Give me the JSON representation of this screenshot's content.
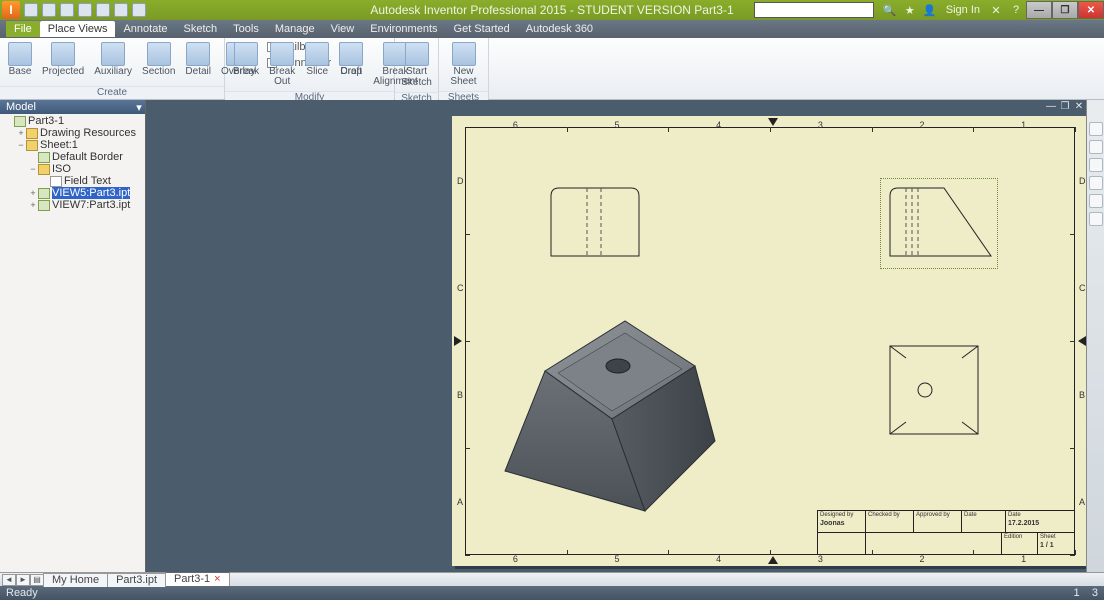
{
  "title": "Autodesk Inventor Professional 2015 - STUDENT VERSION   Part3-1",
  "signin": "Sign In",
  "menus": [
    "File",
    "Place Views",
    "Annotate",
    "Sketch",
    "Tools",
    "Manage",
    "View",
    "Environments",
    "Get Started",
    "Autodesk 360"
  ],
  "activeMenu": "Place Views",
  "ribbon": {
    "create": {
      "title": "Create",
      "buttons": [
        {
          "l": "Base"
        },
        {
          "l": "Projected"
        },
        {
          "l": "Auxiliary"
        },
        {
          "l": "Section"
        },
        {
          "l": "Detail"
        },
        {
          "l": "Overlay"
        }
      ],
      "opts": [
        {
          "l": "Nailboard"
        },
        {
          "l": "Connector"
        }
      ],
      "draft": "Draft"
    },
    "modify": {
      "title": "Modify",
      "buttons": [
        {
          "l": "Break"
        },
        {
          "l": "Break Out"
        },
        {
          "l": "Slice"
        },
        {
          "l": "Crop"
        }
      ],
      "ba": "Break Alignment"
    },
    "sketch": {
      "title": "Sketch",
      "l1": "Start",
      "l2": "Sketch"
    },
    "sheets": {
      "title": "Sheets",
      "l": "New Sheet"
    }
  },
  "browser": {
    "title": "Model",
    "items": [
      {
        "ind": 0,
        "tw": "",
        "ic": "dwg",
        "l": "Part3-1"
      },
      {
        "ind": 1,
        "tw": "+",
        "ic": "f",
        "l": "Drawing Resources"
      },
      {
        "ind": 1,
        "tw": "−",
        "ic": "f",
        "l": "Sheet:1"
      },
      {
        "ind": 2,
        "tw": "",
        "ic": "dwg",
        "l": "Default Border"
      },
      {
        "ind": 2,
        "tw": "−",
        "ic": "f",
        "l": "ISO"
      },
      {
        "ind": 3,
        "tw": "",
        "ic": "txt",
        "l": "Field Text"
      },
      {
        "ind": 2,
        "tw": "+",
        "ic": "dwg",
        "l": "VIEW5:Part3.ipt",
        "sel": true
      },
      {
        "ind": 2,
        "tw": "+",
        "ic": "dwg",
        "l": "VIEW7:Part3.ipt"
      }
    ]
  },
  "tabs": [
    {
      "l": "My Home"
    },
    {
      "l": "Part3.ipt"
    },
    {
      "l": "Part3-1",
      "active": true
    }
  ],
  "status": {
    "left": "Ready",
    "right1": "1",
    "right2": "3"
  },
  "titleblock": {
    "r1": [
      {
        "h": "Designed by",
        "v": "Joonas"
      },
      {
        "h": "Checked by",
        "v": ""
      },
      {
        "h": "Approved by",
        "v": ""
      },
      {
        "h": "Date",
        "v": ""
      },
      {
        "h": "Date",
        "v": "17.2.2015"
      }
    ],
    "r2": {
      "edition_h": "Edition",
      "edition_v": "",
      "sheet_h": "Sheet",
      "sheet_v": "1 / 1"
    }
  },
  "rulerTop": [
    "6",
    "5",
    "4",
    "3",
    "2",
    "1"
  ],
  "rulerSide": [
    "D",
    "C",
    "B",
    "A"
  ]
}
